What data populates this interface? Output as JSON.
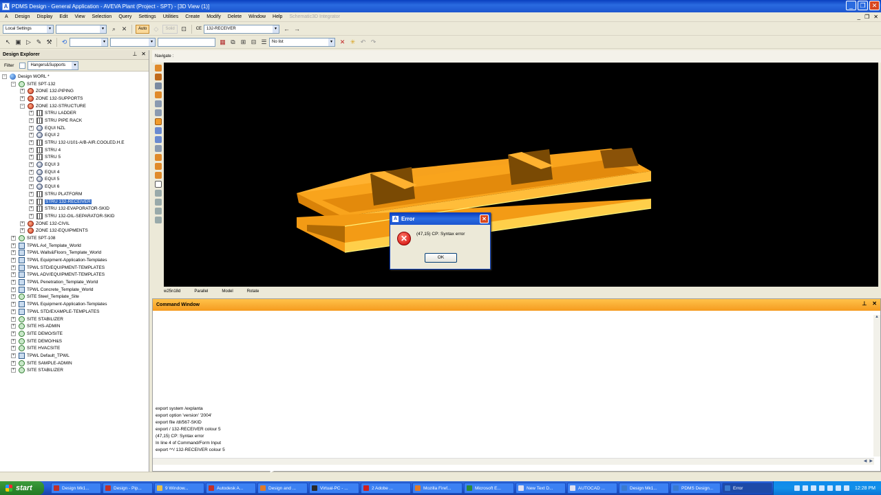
{
  "window": {
    "title": "PDMS Design - General Application - AVEVA Plant (Project - SPT) - [3D View (1)]",
    "app_icon": "A"
  },
  "menu": {
    "items": [
      "Design",
      "Display",
      "Edit",
      "View",
      "Selection",
      "Query",
      "Settings",
      "Utilities",
      "Create",
      "Modify",
      "Delete",
      "Window",
      "Help"
    ],
    "disabled_item": "Schematic3D Integrator"
  },
  "toolbar1": {
    "settings_combo": "Local Settings",
    "auto_label": "Auto",
    "solid_label": "Solid",
    "ce_label": "CE",
    "ce_value": "132-RECEIVER"
  },
  "toolbar2": {
    "list_combo": "No list"
  },
  "explorer": {
    "title": "Design Explorer",
    "filter_label": "Filter",
    "filter_value": "Hangers&Supports",
    "nodes": [
      {
        "label": "Design WORL *",
        "icon": "world-icon",
        "level": 0
      },
      {
        "label": "SITE SPT-132",
        "icon": "site-icon",
        "level": 1
      },
      {
        "label": "ZONE 132-PIPING",
        "icon": "zone-icon",
        "level": 2
      },
      {
        "label": "ZONE 132-SUPPORTS",
        "icon": "zone-icon",
        "level": 2
      },
      {
        "label": "ZONE 132-STRUCTURE",
        "icon": "zone-icon",
        "level": 2
      },
      {
        "label": "STRU LADDER",
        "icon": "stru-icon",
        "level": 3
      },
      {
        "label": "STRU PIPE RACK",
        "icon": "stru-icon",
        "level": 3
      },
      {
        "label": "EQUI NZL",
        "icon": "equi-icon",
        "level": 3
      },
      {
        "label": "EQUI 2",
        "icon": "equi-icon",
        "level": 3
      },
      {
        "label": "STRU 132-U101-A/B-AIR.COOLED.H.E",
        "icon": "stru-icon",
        "level": 3
      },
      {
        "label": "STRU 4",
        "icon": "stru-icon",
        "level": 3
      },
      {
        "label": "STRU 5",
        "icon": "stru-icon",
        "level": 3
      },
      {
        "label": "EQUI 3",
        "icon": "equi-icon",
        "level": 3
      },
      {
        "label": "EQUI 4",
        "icon": "equi-icon",
        "level": 3
      },
      {
        "label": "EQUI 5",
        "icon": "equi-icon",
        "level": 3
      },
      {
        "label": "EQUI 6",
        "icon": "equi-icon",
        "level": 3
      },
      {
        "label": "STRU PLATFORM",
        "icon": "stru-icon",
        "level": 3
      },
      {
        "label": "STRU 132-RECEIVER",
        "icon": "stru-icon",
        "level": 3
      },
      {
        "label": "STRU 132-EVAPORATOR-SKID",
        "icon": "stru-icon",
        "level": 3
      },
      {
        "label": "STRU 132-OIL-SEPARATOR-SKID",
        "icon": "stru-icon",
        "level": 3
      },
      {
        "label": "ZONE 132-CIVIL",
        "icon": "zone-icon",
        "level": 2
      },
      {
        "label": "ZONE 132-EQUIPMENTS",
        "icon": "zone-icon",
        "level": 2
      },
      {
        "label": "SITE SPT-108",
        "icon": "site-icon",
        "level": 1
      },
      {
        "label": "TPWL Axl_Template_World",
        "icon": "tpwl-icon",
        "level": 1
      },
      {
        "label": "TPWL Walls&Floors_Template_World",
        "icon": "tpwl-icon",
        "level": 1
      },
      {
        "label": "TPWL Equipment-Application-Templates",
        "icon": "tpwl-icon",
        "level": 1
      },
      {
        "label": "TPWL STD/EQUIPMENT-TEMPLATES",
        "icon": "tpwl-icon",
        "level": 1
      },
      {
        "label": "TPWL ADV/EQUIPMENT-TEMPLATES",
        "icon": "tpwl-icon",
        "level": 1
      },
      {
        "label": "TPWL Penetration_Template_World",
        "icon": "tpwl-icon",
        "level": 1
      },
      {
        "label": "TPWL Concrete_Template_World",
        "icon": "tpwl-icon",
        "level": 1
      },
      {
        "label": "SITE Steel_Template_Site",
        "icon": "site-icon",
        "level": 1
      },
      {
        "label": "TPWL Equipment-Application-Templates",
        "icon": "tpwl-icon",
        "level": 1
      },
      {
        "label": "TPWL STD/EXAMPLE-TEMPLATES",
        "icon": "tpwl-icon",
        "level": 1
      },
      {
        "label": "SITE STABILIZER",
        "icon": "site-icon",
        "level": 1
      },
      {
        "label": "SITE HS-ADMIN",
        "icon": "site-icon",
        "level": 1
      },
      {
        "label": "SITE DEMO/SITE",
        "icon": "site-icon",
        "level": 1
      },
      {
        "label": "SITE DEMO/H&S",
        "icon": "site-icon",
        "level": 1
      },
      {
        "label": "SITE HVACSITE",
        "icon": "site-icon",
        "level": 1
      },
      {
        "label": "TPWL Default_TPWL",
        "icon": "tpwl-icon",
        "level": 1
      },
      {
        "label": "SITE SAMPLE-ADMIN",
        "icon": "site-icon",
        "level": 1
      },
      {
        "label": "SITE STABILIZER",
        "icon": "site-icon",
        "level": 1
      }
    ],
    "selected_label": "STRU 132-RECEIVER"
  },
  "view3d": {
    "navigate_label": "Navigate :",
    "status": [
      "w25n18d",
      "Parallel",
      "Model",
      "Rotate"
    ],
    "model_color": "#ffa51c"
  },
  "command_window": {
    "title": "Command Window",
    "lines": [
      "export system /explanta",
      "export option 'version' '2004'",
      "export file /dl/567-SKID",
      "export / 132-RECEIVER colour 5",
      "(47,15)   CP: Syntax error",
      " In line 4 of Command/Form Input",
      "export ^^/ 132-RECEIVER colour 5"
    ]
  },
  "error_dialog": {
    "title": "Error",
    "message": "(47,15)   CP: Syntax error",
    "ok_label": "OK"
  },
  "taskbar": {
    "start_label": "start",
    "tasks": [
      {
        "label": "Design Mk1...",
        "icon_color": "#c0302a"
      },
      {
        "label": "Design - Pip...",
        "icon_color": "#c0302a"
      },
      {
        "label": "9 Window...",
        "icon_color": "#e8c04a"
      },
      {
        "label": "Autodesk A...",
        "icon_color": "#c0302a"
      },
      {
        "label": "Design and ...",
        "icon_color": "#e07a2a"
      },
      {
        "label": "Virtual-PC - ...",
        "icon_color": "#2a2a2a"
      },
      {
        "label": "2 Adobe ...",
        "icon_color": "#d02020"
      },
      {
        "label": "Mozilla Firef...",
        "icon_color": "#e07a2a"
      },
      {
        "label": "Microsoft E...",
        "icon_color": "#2a8a3a"
      },
      {
        "label": "New Text D...",
        "icon_color": "#e0e0f0"
      },
      {
        "label": "AUTOCAD ...",
        "icon_color": "#e0e0f0"
      },
      {
        "label": "Design Mk1...",
        "icon_color": "#3a7ad0"
      },
      {
        "label": "PDMS Design...",
        "icon_color": "#3a7ad0"
      },
      {
        "label": "Error",
        "icon_color": "#3a7ad0"
      }
    ],
    "clock": "12:28 PM"
  }
}
